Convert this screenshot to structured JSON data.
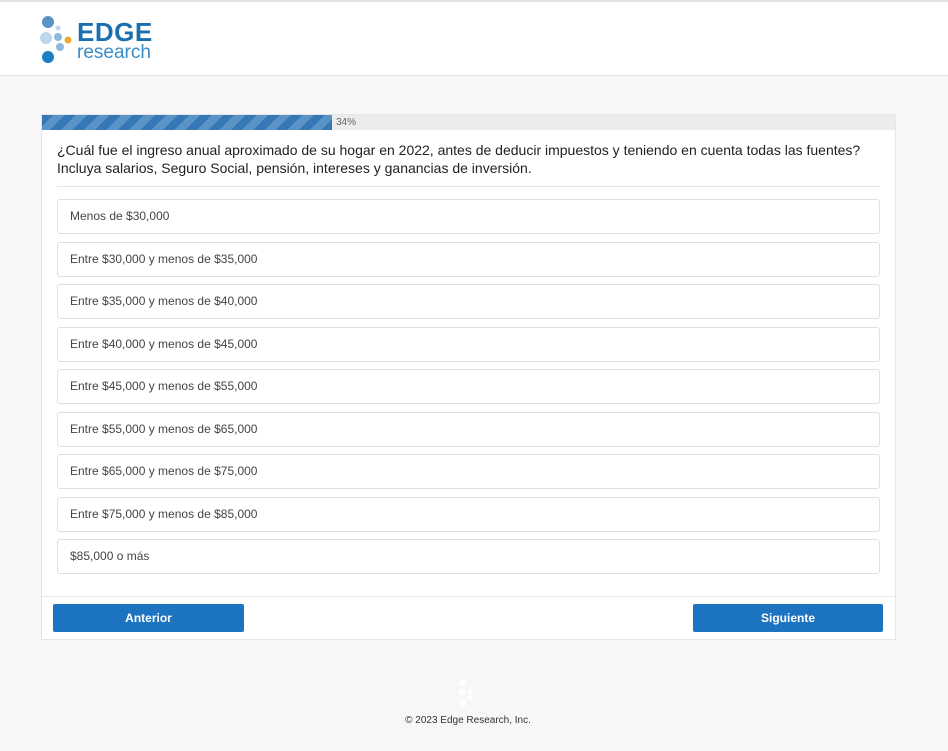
{
  "header": {
    "logo_word1": "EDGE",
    "logo_word2": "research"
  },
  "progress": {
    "percent": 34,
    "label": "34%"
  },
  "question": {
    "text": "¿Cuál fue el ingreso anual aproximado de su hogar en 2022, antes de deducir impuestos y teniendo en cuenta todas las fuentes? Incluya salarios, Seguro Social, pensión, intereses y ganancias de inversión."
  },
  "options": [
    "Menos de $30,000",
    "Entre $30,000 y menos de $35,000",
    "Entre $35,000 y menos de $40,000",
    "Entre $40,000 y menos de $45,000",
    "Entre $45,000 y menos de $55,000",
    "Entre $55,000 y menos de $65,000",
    "Entre $65,000 y menos de $75,000",
    "Entre $75,000 y menos de $85,000",
    "$85,000 o más"
  ],
  "nav": {
    "prev_label": "Anterior",
    "next_label": "Siguiente"
  },
  "footer": {
    "copyright": "© 2023 Edge Research, Inc."
  },
  "colors": {
    "brand_blue": "#1b6fae",
    "button_blue": "#1c74c1",
    "accent_orange": "#f0a830"
  }
}
